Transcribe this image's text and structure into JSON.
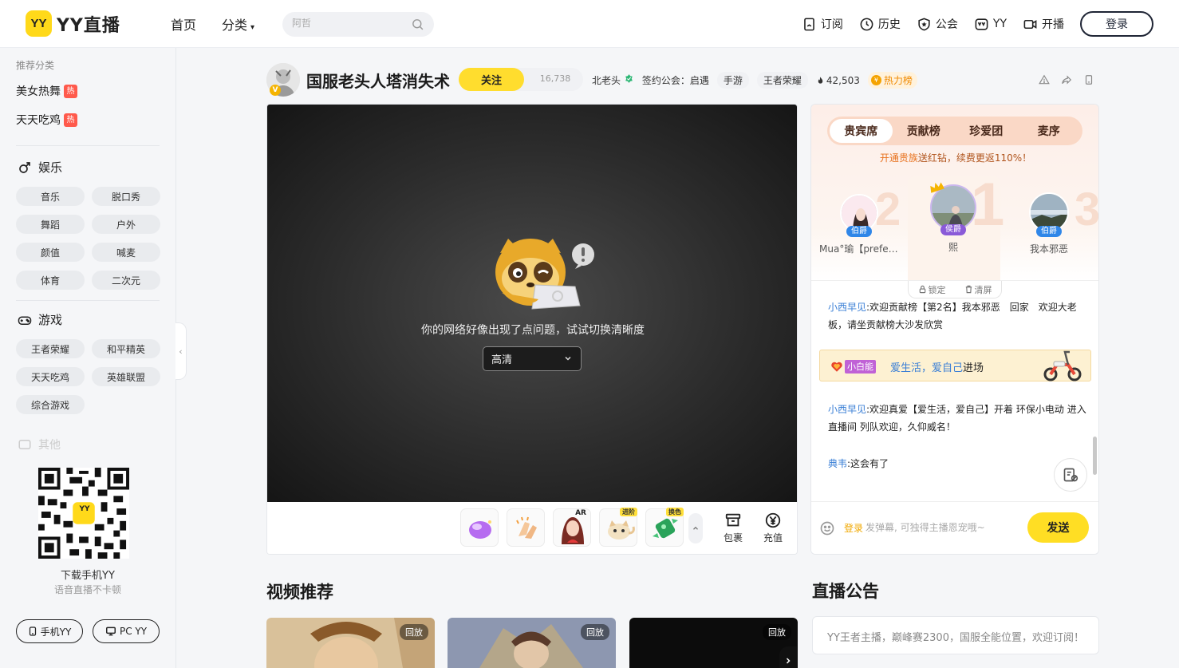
{
  "header": {
    "logo_badge": "YY",
    "logo_text": "YY直播",
    "nav": {
      "home": "首页",
      "category": "分类"
    },
    "search": {
      "placeholder": "阿哲"
    },
    "links": {
      "subscribe": "订阅",
      "history": "历史",
      "guild": "公会",
      "yy": "YY",
      "broadcast": "开播"
    },
    "login": "登录"
  },
  "sidebar": {
    "recommend_title": "推荐分类",
    "recommend": [
      {
        "label": "美女热舞",
        "badge": "热"
      },
      {
        "label": "天天吃鸡",
        "badge": "热"
      }
    ],
    "entertainment": {
      "title": "娱乐",
      "items": [
        "音乐",
        "脱口秀",
        "舞蹈",
        "户外",
        "颜值",
        "喊麦",
        "体育",
        "二次元"
      ]
    },
    "games": {
      "title": "游戏",
      "items": [
        "王者荣耀",
        "和平精英",
        "天天吃鸡",
        "英雄联盟",
        "综合游戏"
      ]
    },
    "other_title": "其他",
    "download": {
      "qr_label": "YY",
      "title": "下载手机YY",
      "subtitle": "语音直播不卡顿",
      "mobile_btn": "手机YY",
      "pc_btn": "PC YY"
    }
  },
  "room": {
    "title": "国服老头人塔消失术",
    "avatar_badge": "V",
    "follow_label": "关注",
    "follow_count": "16,738",
    "anchor": "北老头",
    "guild": "签约公会：启遇",
    "tags": [
      "手游",
      "王者荣耀"
    ],
    "heat": "42,503",
    "rank_label": "热力榜",
    "rank_icon": "¥"
  },
  "player": {
    "error_text": "你的网络好像出现了点问题，试试切换清晰度",
    "quality": "高清",
    "gift_tags": [
      "AR",
      "进阶",
      "换色"
    ],
    "package": "包裹",
    "recharge": "充值"
  },
  "chat": {
    "tabs": [
      "贵宾席",
      "贡献榜",
      "珍爱团",
      "麦序"
    ],
    "active_tab": 0,
    "promo_highlight": "开通贵族",
    "promo_rest": "送红钻，续费更返110%！",
    "rank_nums": [
      "2",
      "1",
      "3"
    ],
    "ranks": [
      {
        "name": "Mua°瑜【prefere…",
        "badge": "伯爵"
      },
      {
        "name": "熙",
        "badge": "侯爵"
      },
      {
        "name": "我本邪恶",
        "badge": "伯爵"
      }
    ],
    "lock": "锁定",
    "clear": "清屏",
    "messages": [
      {
        "user": "小西早见",
        "text": ":欢迎贡献榜【第2名】我本邪恶　回家　欢迎大老板，请坐贡献榜大沙发欣赏"
      },
      {
        "user": "小西早见",
        "text": ":欢迎真爱【爱生活，爱自己】开着 环保小电动 进入直播间 列队欢迎，久仰威名！"
      },
      {
        "user": "典韦",
        "text": ":这会有了"
      }
    ],
    "enter": {
      "level_name": "小白能",
      "user": "爱生活，爱自己",
      "action": "进场"
    },
    "input_login": "登录",
    "input_placeholder": "发弹幕, 可独得主播恩宠哦~",
    "send": "发送"
  },
  "bottom": {
    "video_title": "视频推荐",
    "replay": "回放",
    "announce_title": "直播公告",
    "announce_text": "YY王者主播，巅峰赛2300，国服全能位置，欢迎订阅！"
  }
}
